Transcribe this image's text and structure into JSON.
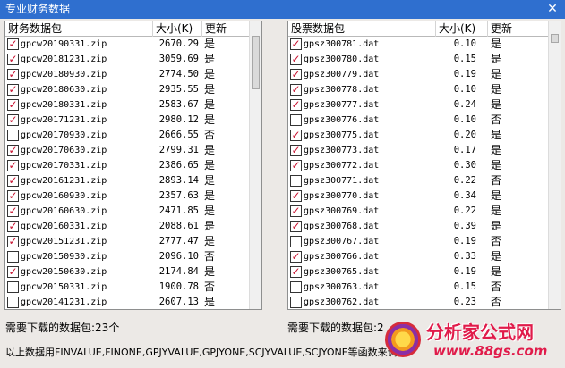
{
  "window": {
    "title": "专业财务数据",
    "close": "✕"
  },
  "left": {
    "headers": {
      "name": "财务数据包",
      "size": "大小(K)",
      "updated": "更新"
    },
    "rows": [
      {
        "checked": true,
        "name": "gpcw20190331.zip",
        "size": "2670.29",
        "updated": "是"
      },
      {
        "checked": true,
        "name": "gpcw20181231.zip",
        "size": "3059.69",
        "updated": "是"
      },
      {
        "checked": true,
        "name": "gpcw20180930.zip",
        "size": "2774.50",
        "updated": "是"
      },
      {
        "checked": true,
        "name": "gpcw20180630.zip",
        "size": "2935.55",
        "updated": "是"
      },
      {
        "checked": true,
        "name": "gpcw20180331.zip",
        "size": "2583.67",
        "updated": "是"
      },
      {
        "checked": true,
        "name": "gpcw20171231.zip",
        "size": "2980.12",
        "updated": "是"
      },
      {
        "checked": false,
        "name": "gpcw20170930.zip",
        "size": "2666.55",
        "updated": "否"
      },
      {
        "checked": true,
        "name": "gpcw20170630.zip",
        "size": "2799.31",
        "updated": "是"
      },
      {
        "checked": true,
        "name": "gpcw20170331.zip",
        "size": "2386.65",
        "updated": "是"
      },
      {
        "checked": true,
        "name": "gpcw20161231.zip",
        "size": "2893.14",
        "updated": "是"
      },
      {
        "checked": true,
        "name": "gpcw20160930.zip",
        "size": "2357.63",
        "updated": "是"
      },
      {
        "checked": true,
        "name": "gpcw20160630.zip",
        "size": "2471.85",
        "updated": "是"
      },
      {
        "checked": true,
        "name": "gpcw20160331.zip",
        "size": "2088.61",
        "updated": "是"
      },
      {
        "checked": true,
        "name": "gpcw20151231.zip",
        "size": "2777.47",
        "updated": "是"
      },
      {
        "checked": false,
        "name": "gpcw20150930.zip",
        "size": "2096.10",
        "updated": "否"
      },
      {
        "checked": true,
        "name": "gpcw20150630.zip",
        "size": "2174.84",
        "updated": "是"
      },
      {
        "checked": false,
        "name": "gpcw20150331.zip",
        "size": "1900.78",
        "updated": "否"
      },
      {
        "checked": false,
        "name": "gpcw20141231.zip",
        "size": "2607.13",
        "updated": "是"
      }
    ],
    "status": "需要下载的数据包:23个"
  },
  "right": {
    "headers": {
      "name": "股票数据包",
      "size": "大小(K)",
      "updated": "更新"
    },
    "rows": [
      {
        "checked": true,
        "name": "gpsz300781.dat",
        "size": "0.10",
        "updated": "是"
      },
      {
        "checked": true,
        "name": "gpsz300780.dat",
        "size": "0.15",
        "updated": "是"
      },
      {
        "checked": true,
        "name": "gpsz300779.dat",
        "size": "0.19",
        "updated": "是"
      },
      {
        "checked": true,
        "name": "gpsz300778.dat",
        "size": "0.10",
        "updated": "是"
      },
      {
        "checked": true,
        "name": "gpsz300777.dat",
        "size": "0.24",
        "updated": "是"
      },
      {
        "checked": false,
        "name": "gpsz300776.dat",
        "size": "0.10",
        "updated": "否"
      },
      {
        "checked": true,
        "name": "gpsz300775.dat",
        "size": "0.20",
        "updated": "是"
      },
      {
        "checked": true,
        "name": "gpsz300773.dat",
        "size": "0.17",
        "updated": "是"
      },
      {
        "checked": true,
        "name": "gpsz300772.dat",
        "size": "0.30",
        "updated": "是"
      },
      {
        "checked": false,
        "name": "gpsz300771.dat",
        "size": "0.22",
        "updated": "否"
      },
      {
        "checked": true,
        "name": "gpsz300770.dat",
        "size": "0.34",
        "updated": "是"
      },
      {
        "checked": true,
        "name": "gpsz300769.dat",
        "size": "0.22",
        "updated": "是"
      },
      {
        "checked": true,
        "name": "gpsz300768.dat",
        "size": "0.39",
        "updated": "是"
      },
      {
        "checked": false,
        "name": "gpsz300767.dat",
        "size": "0.19",
        "updated": "否"
      },
      {
        "checked": true,
        "name": "gpsz300766.dat",
        "size": "0.33",
        "updated": "是"
      },
      {
        "checked": true,
        "name": "gpsz300765.dat",
        "size": "0.19",
        "updated": "是"
      },
      {
        "checked": false,
        "name": "gpsz300763.dat",
        "size": "0.15",
        "updated": "否"
      },
      {
        "checked": false,
        "name": "gpsz300762.dat",
        "size": "0.23",
        "updated": "否"
      }
    ],
    "status": "需要下载的数据包:2"
  },
  "footer": "以上数据用FINVALUE,FINONE,GPJYVALUE,GPJYONE,SCJYVALUE,SCJYONE等函数来调用",
  "watermark": {
    "line1": "分析家公式网",
    "line2": "www.88gs.com"
  },
  "colors": {
    "titlebar": "#2f6fcf",
    "check": "#c8102e",
    "watermark": "#e01b4a"
  }
}
